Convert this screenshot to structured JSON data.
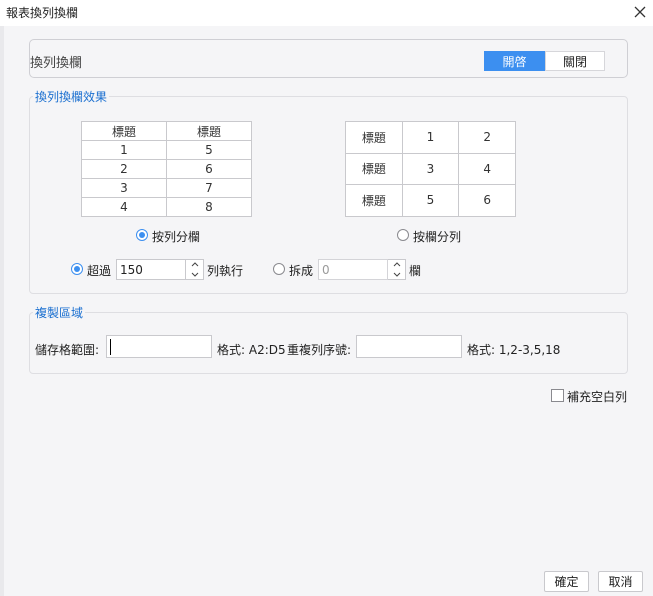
{
  "window": {
    "title": "報表換列換欄"
  },
  "toggle": {
    "label": "換列換欄",
    "on_label": "開啓",
    "off_label": "關閉",
    "selected": "開啓",
    "accent": "#3c8ff0"
  },
  "effect": {
    "title": "換列換欄效果",
    "by_row": {
      "headers": [
        "標題",
        "標題"
      ],
      "rows": [
        [
          "1",
          "5"
        ],
        [
          "2",
          "6"
        ],
        [
          "3",
          "7"
        ],
        [
          "4",
          "8"
        ]
      ],
      "radio_label": "按列分欄",
      "selected": true
    },
    "by_col": {
      "rows": [
        [
          "標題",
          "1",
          "2"
        ],
        [
          "標題",
          "3",
          "4"
        ],
        [
          "標題",
          "5",
          "6"
        ]
      ],
      "radio_label": "按欄分列",
      "selected": false
    },
    "exceed": {
      "label": "超過",
      "value": "150",
      "suffix": "列執行",
      "selected": true
    },
    "split": {
      "label": "拆成",
      "value": "0",
      "suffix": "欄",
      "selected": false
    }
  },
  "copy": {
    "title": "複製區域",
    "range_label": "儲存格範圍:",
    "range_value": "",
    "range_format": "格式: A2:D5",
    "repeat_label": "重複列序號:",
    "repeat_value": "",
    "repeat_format": "格式: 1,2-3,5,18"
  },
  "fill_blank": {
    "label": "補充空白列",
    "checked": false
  },
  "buttons": {
    "ok": "確定",
    "cancel": "取消"
  }
}
